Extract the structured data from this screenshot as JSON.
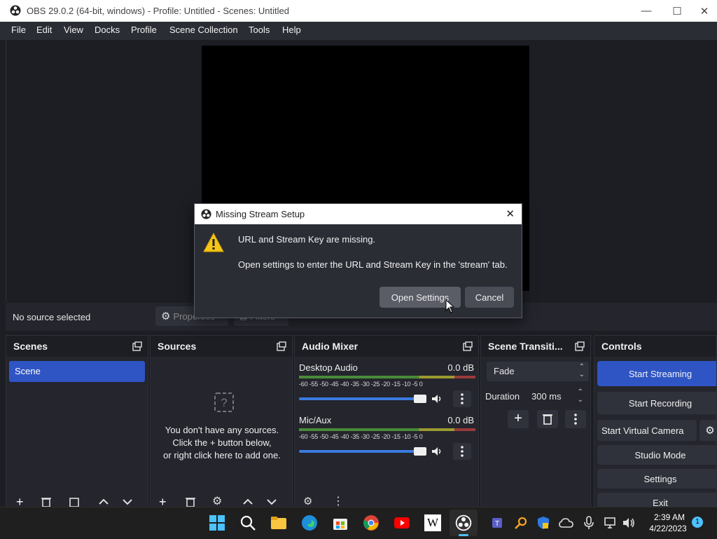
{
  "window": {
    "title": "OBS 29.0.2 (64-bit, windows) - Profile: Untitled - Scenes: Untitled",
    "minimize": "—",
    "maximize": "☐",
    "close": "✕"
  },
  "menu": [
    "File",
    "Edit",
    "View",
    "Docks",
    "Profile",
    "Scene Collection",
    "Tools",
    "Help"
  ],
  "source_toolbar": {
    "status": "No source selected",
    "properties_label": "Properties",
    "filters_label": "Filters"
  },
  "docks": {
    "scenes": {
      "title": "Scenes",
      "items": [
        "Scene"
      ]
    },
    "sources": {
      "title": "Sources",
      "empty_line1": "You don't have any sources.",
      "empty_line2": "Click the + button below,",
      "empty_line3": "or right click here to add one."
    },
    "audio_mixer": {
      "title": "Audio Mixer",
      "channels": [
        {
          "name": "Desktop Audio",
          "level": "0.0 dB",
          "volume": 1.0
        },
        {
          "name": "Mic/Aux",
          "level": "0.0 dB",
          "volume": 1.0
        }
      ],
      "scale": "-60 -55 -50 -45 -40 -35 -30 -25 -20 -15 -10 -5 0"
    },
    "scene_transitions": {
      "title": "Scene Transiti...",
      "transition": "Fade",
      "duration_label": "Duration",
      "duration_value": "300 ms"
    },
    "controls": {
      "title": "Controls",
      "start_streaming": "Start Streaming",
      "start_recording": "Start Recording",
      "start_virtual_camera": "Start Virtual Camera",
      "studio_mode": "Studio Mode",
      "settings": "Settings",
      "exit": "Exit"
    }
  },
  "dialog": {
    "title": "Missing Stream Setup",
    "message": "URL and Stream Key are missing.",
    "detail": "Open settings to enter the URL and Stream Key in the 'stream' tab.",
    "open_settings": "Open Settings",
    "cancel": "Cancel"
  },
  "taskbar": {
    "time": "2:39 AM",
    "date": "4/22/2023",
    "notification_count": "1",
    "wikipedia_glyph": "W"
  },
  "colors": {
    "accent": "#2f55c4",
    "background": "#1d1e24",
    "panel": "#24252d"
  }
}
